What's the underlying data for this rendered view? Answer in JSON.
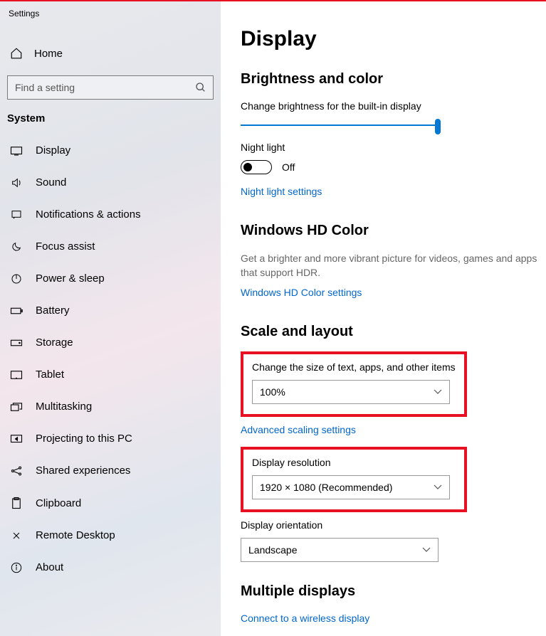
{
  "window": {
    "title": "Settings"
  },
  "sidebar": {
    "home": "Home",
    "search_placeholder": "Find a setting",
    "section": "System",
    "items": [
      {
        "label": "Display"
      },
      {
        "label": "Sound"
      },
      {
        "label": "Notifications & actions"
      },
      {
        "label": "Focus assist"
      },
      {
        "label": "Power & sleep"
      },
      {
        "label": "Battery"
      },
      {
        "label": "Storage"
      },
      {
        "label": "Tablet"
      },
      {
        "label": "Multitasking"
      },
      {
        "label": "Projecting to this PC"
      },
      {
        "label": "Shared experiences"
      },
      {
        "label": "Clipboard"
      },
      {
        "label": "Remote Desktop"
      },
      {
        "label": "About"
      }
    ]
  },
  "main": {
    "heading": "Display",
    "brightness": {
      "title": "Brightness and color",
      "slider_label": "Change brightness for the built-in display",
      "nightlight_label": "Night light",
      "nightlight_state": "Off",
      "nightlight_link": "Night light settings"
    },
    "hdcolor": {
      "title": "Windows HD Color",
      "desc": "Get a brighter and more vibrant picture for videos, games and apps that support HDR.",
      "link": "Windows HD Color settings"
    },
    "scale": {
      "title": "Scale and layout",
      "size_label": "Change the size of text, apps, and other items",
      "size_value": "100%",
      "advanced_link": "Advanced scaling settings",
      "resolution_label": "Display resolution",
      "resolution_value": "1920 × 1080 (Recommended)",
      "orientation_label": "Display orientation",
      "orientation_value": "Landscape"
    },
    "multiple": {
      "title": "Multiple displays",
      "link": "Connect to a wireless display"
    }
  }
}
